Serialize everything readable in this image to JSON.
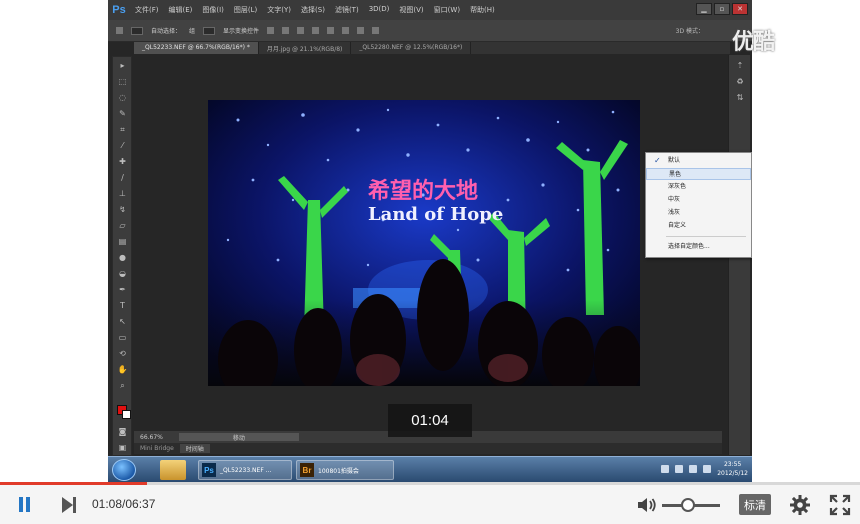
{
  "ps": {
    "logo": "Ps",
    "menu": [
      "文件(F)",
      "编辑(E)",
      "图像(I)",
      "图层(L)",
      "文字(Y)",
      "选择(S)",
      "滤镜(T)",
      "3D(D)",
      "视图(V)",
      "窗口(W)",
      "帮助(H)"
    ],
    "win_controls": [
      "▁",
      "▫",
      "✕"
    ],
    "options": {
      "auto_select": "自动选择：",
      "auto_select_value": "组",
      "show_transform": "显示变换控件",
      "mode_3d": "3D 模式："
    },
    "tabs": [
      "_QL52233.NEF @ 66.7%(RGB/16*) *",
      "月月.jpg @ 21.1%(RGB/8)",
      "_QL52280.NEF @ 12.5%(RGB/16*)"
    ],
    "context_menu": {
      "items": [
        "默认",
        "黑色",
        "深灰色",
        "中灰",
        "浅灰",
        "自定义",
        "选择自定颜色..."
      ],
      "checked_index": 0,
      "highlighted_index": 1
    },
    "status": {
      "zoom": "66.67%",
      "track_label": "移动"
    },
    "minibar": [
      "Mini Bridge",
      "时间轴"
    ]
  },
  "taskbar": {
    "tasks": [
      {
        "icon": "Ps",
        "label": "_QL52233.NEF ..."
      },
      {
        "icon": "Br",
        "label": "100801拍摄会"
      }
    ],
    "clock_time": "23:55",
    "clock_date": "2012/5/12"
  },
  "watermark": "优酷",
  "time_overlay": "01:04",
  "player": {
    "timecode": "01:08/06:37",
    "progress": 0.171,
    "volume": 0.45,
    "quality_label": "标清"
  },
  "colors": {
    "accent": "#2476c4",
    "progress": "#e13b2a",
    "fg_swatch": "#e01010"
  }
}
